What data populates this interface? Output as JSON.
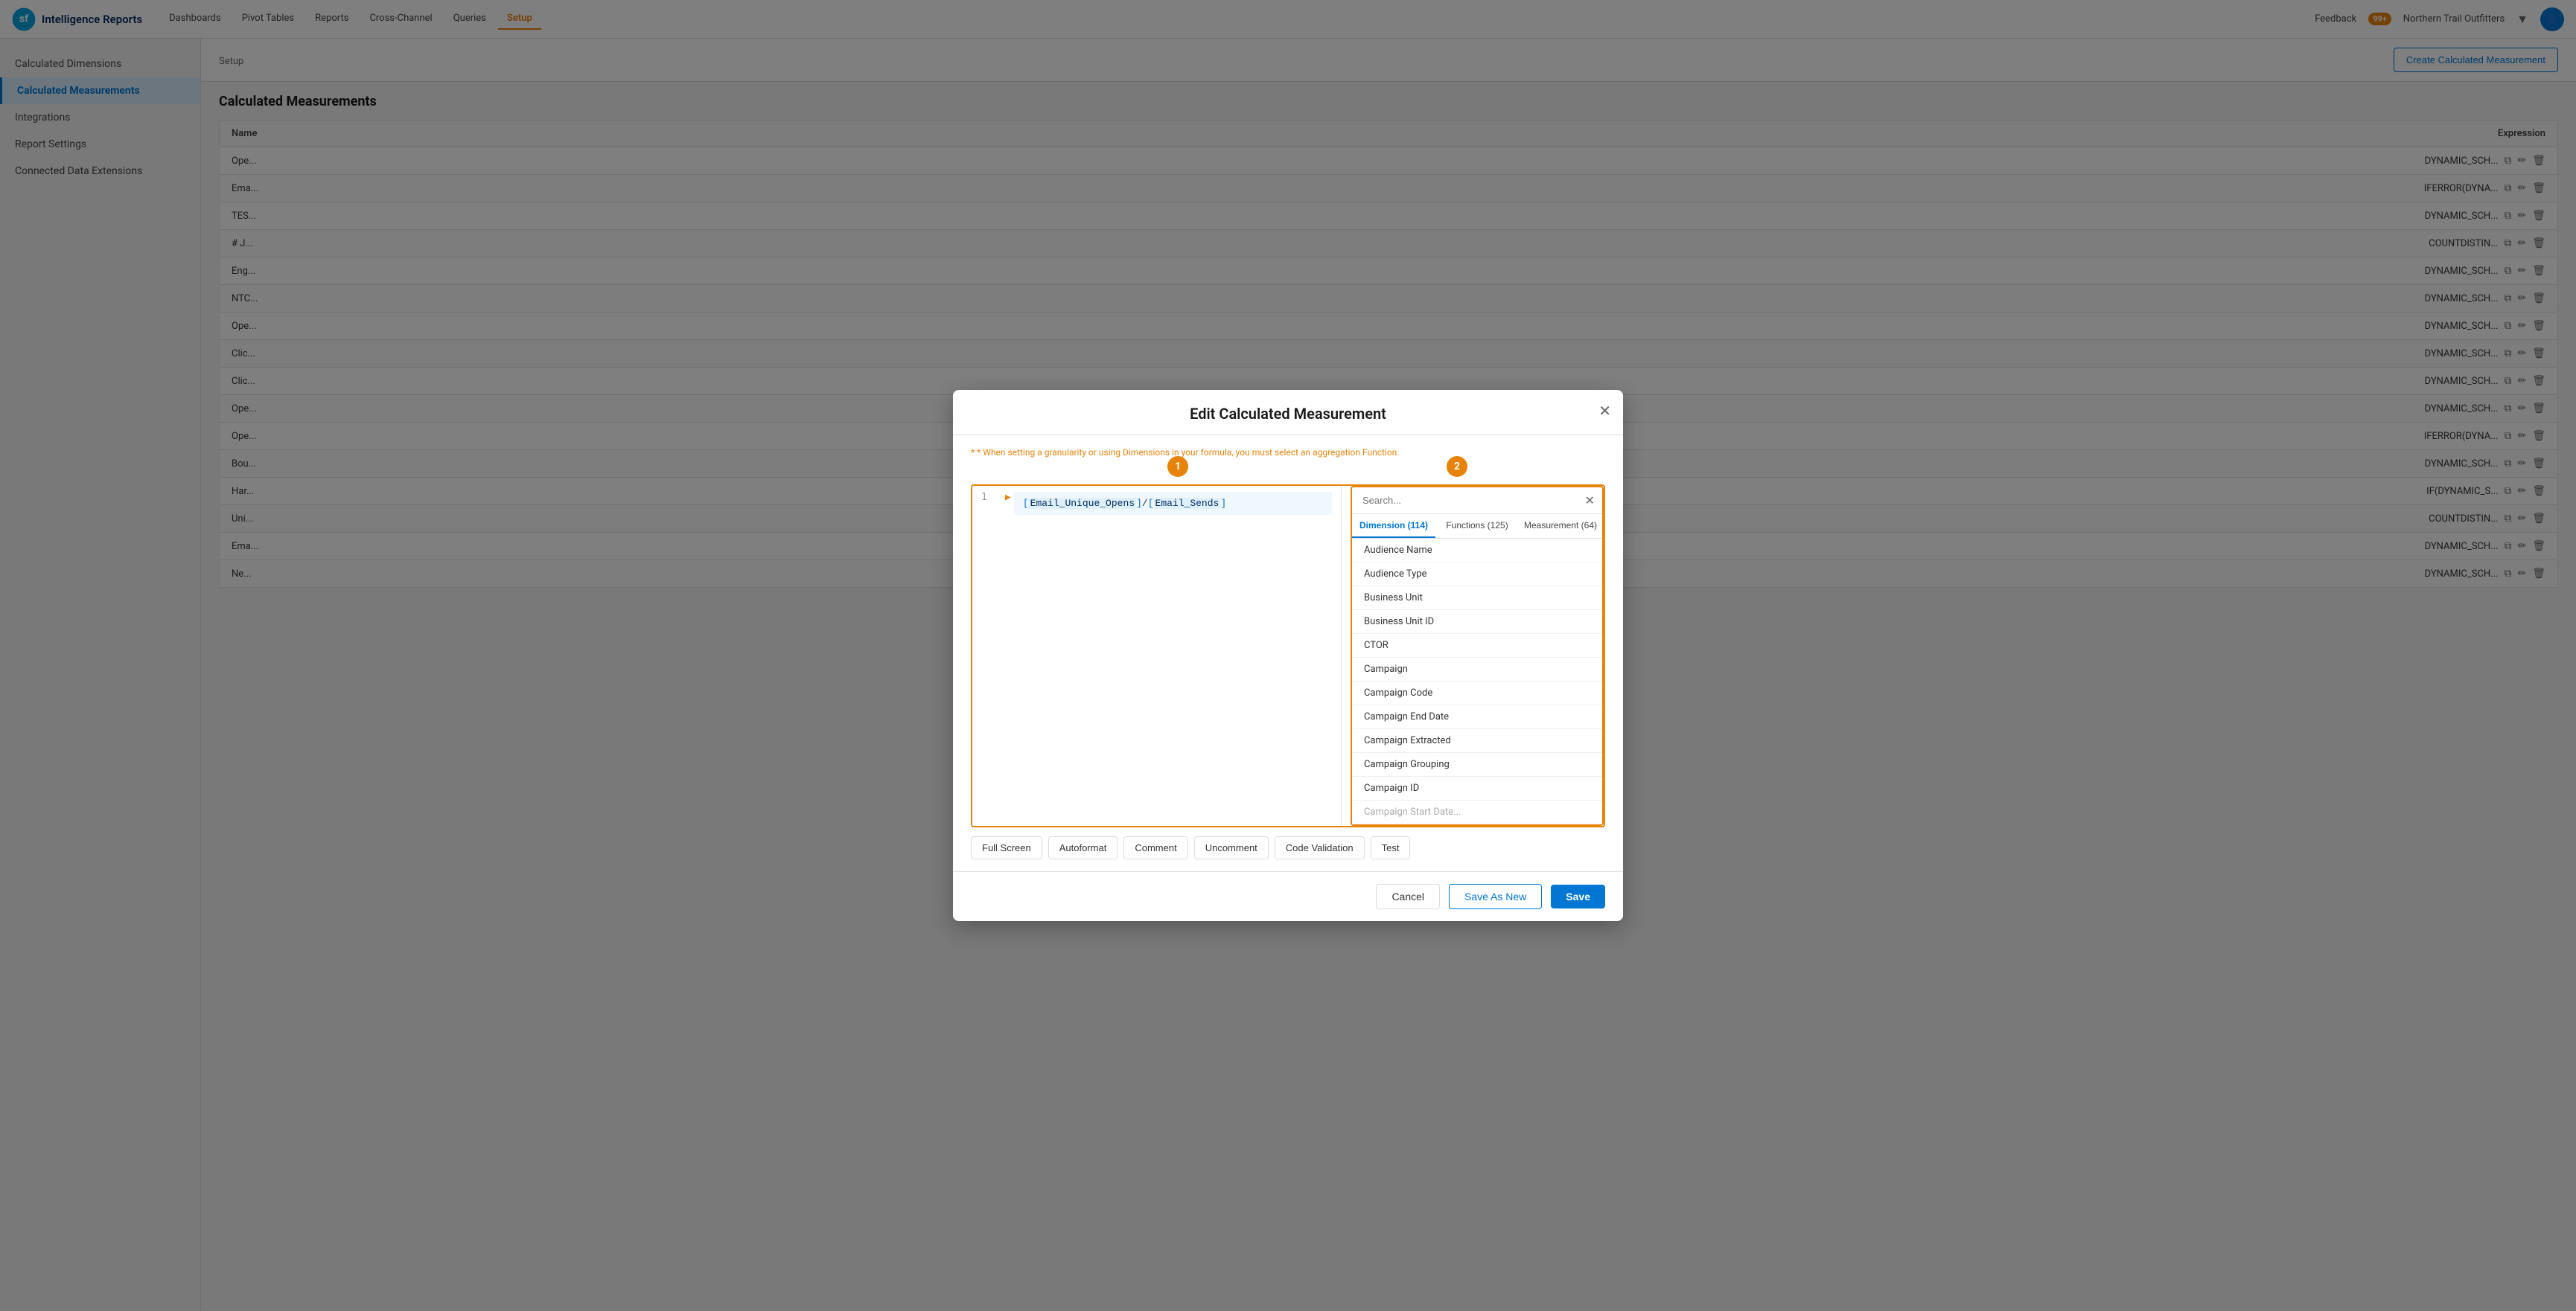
{
  "app": {
    "name": "Intelligence Reports"
  },
  "nav": {
    "links": [
      {
        "label": "Dashboards",
        "active": false
      },
      {
        "label": "Pivot Tables",
        "active": false
      },
      {
        "label": "Reports",
        "active": false
      },
      {
        "label": "Cross-Channel",
        "active": false
      },
      {
        "label": "Queries",
        "active": false
      },
      {
        "label": "Setup",
        "active": true
      }
    ],
    "feedback": "Feedback",
    "notif_count": "99+",
    "org_name": "Northern Trail Outfitters"
  },
  "sidebar": {
    "items": [
      {
        "label": "Calculated Dimensions",
        "active": false
      },
      {
        "label": "Calculated Measurements",
        "active": true
      },
      {
        "label": "Integrations",
        "active": false
      },
      {
        "label": "Report Settings",
        "active": false
      },
      {
        "label": "Connected Data Extensions",
        "active": false
      }
    ]
  },
  "page": {
    "setup_label": "Setup",
    "page_label": "Calculated Measurements",
    "create_btn": "Create Calculated Measurement",
    "table": {
      "col_name": "Name",
      "col_expression": "Expression",
      "rows": [
        {
          "name": "Ope...",
          "expression": "DYNAMIC_SCH..."
        },
        {
          "name": "Ema...",
          "expression": "IFERROR(DYNA..."
        },
        {
          "name": "TES...",
          "expression": "DYNAMIC_SCH..."
        },
        {
          "name": "# J...",
          "expression": "COUNTDISTIN..."
        },
        {
          "name": "Eng...",
          "expression": "DYNAMIC_SCH..."
        },
        {
          "name": "NTC...",
          "expression": "DYNAMIC_SCH..."
        },
        {
          "name": "Ope...",
          "expression": "DYNAMIC_SCH..."
        },
        {
          "name": "Clic...",
          "expression": "DYNAMIC_SCH..."
        },
        {
          "name": "Clic...",
          "expression": "DYNAMIC_SCH..."
        },
        {
          "name": "Ope...",
          "expression": "DYNAMIC_SCH..."
        },
        {
          "name": "Ope...",
          "expression": "IFERROR(DYNA..."
        },
        {
          "name": "Bou...",
          "expression": "DYNAMIC_SCH..."
        },
        {
          "name": "Har...",
          "expression": "IF(DYNAMIC_S..."
        },
        {
          "name": "Uni...",
          "expression": "COUNTDISTIN..."
        },
        {
          "name": "Ema...",
          "expression": "DYNAMIC_SCH..."
        },
        {
          "name": "Ne...",
          "expression": "DYNAMIC_SCH..."
        }
      ]
    }
  },
  "modal": {
    "title": "Edit Calculated Measurement",
    "note": "* When setting a granularity or using Dimensions in your formula, you must select an aggregation Function.",
    "step1": "1",
    "step2": "2",
    "code": "[Email_Unique_Opens]/[Email_Sends]",
    "search_placeholder": "Search...",
    "tabs": [
      {
        "label": "Dimension (114)",
        "active": true
      },
      {
        "label": "Functions (125)",
        "active": false
      },
      {
        "label": "Measurement (64)",
        "active": false
      }
    ],
    "dimension_items": [
      "Audience Name",
      "Audience Type",
      "Business Unit",
      "Business Unit ID",
      "CTOR",
      "Campaign",
      "Campaign Code",
      "Campaign End Date",
      "Campaign Extracted",
      "Campaign Grouping",
      "Campaign ID",
      "Campaign Start Date..."
    ],
    "toolbar": {
      "full_screen": "Full Screen",
      "autoformat": "Autoformat",
      "comment": "Comment",
      "uncomment": "Uncomment",
      "code_validation": "Code Validation",
      "test": "Test"
    },
    "footer": {
      "cancel": "Cancel",
      "save_as_new": "Save As New",
      "save": "Save"
    }
  }
}
